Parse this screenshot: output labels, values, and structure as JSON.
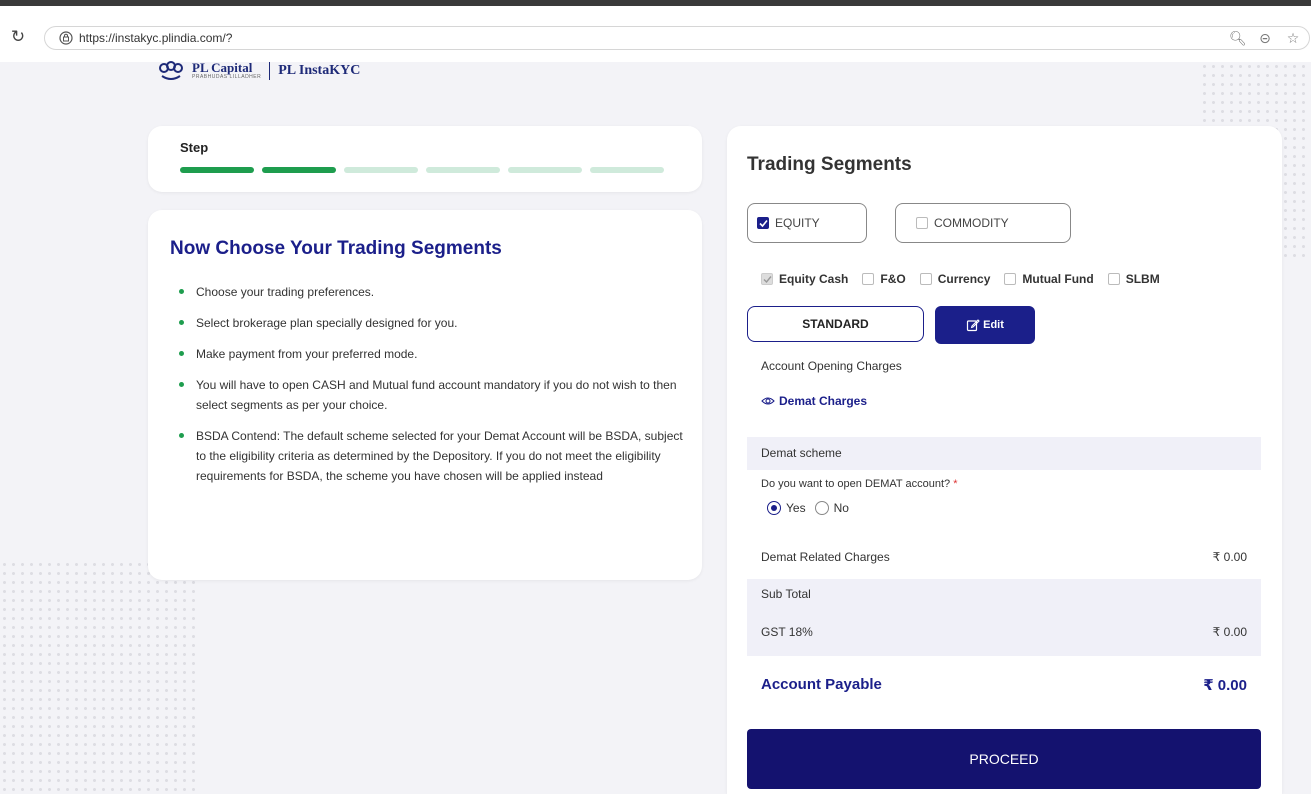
{
  "browser": {
    "url": "https://instakyc.plindia.com/?",
    "reload_icon": "reload-icon",
    "zoom_icon": "zoom-icon",
    "minus_icon": "zoom-out-icon",
    "star_icon": "bookmark-star-icon"
  },
  "logo": {
    "brand": "PL Capital",
    "tagline": "PRABHUDAS LILLADHER",
    "product": "PL InstaKYC"
  },
  "steps": {
    "label": "Step",
    "total": 6,
    "completed": 2
  },
  "info": {
    "title": "Now Choose Your Trading Segments",
    "bullets": [
      "Choose your trading preferences.",
      "Select brokerage plan specially designed for you.",
      "Make payment from your preferred mode.",
      "You will have to open CASH and Mutual fund account mandatory if you do not wish to then select segments as per your choice.",
      "BSDA Contend: The default scheme selected for your Demat Account will be BSDA, subject to the eligibility criteria as determined by the Depository. If you do not meet the eligibility requirements for BSDA, the scheme you have chosen will be applied instead"
    ]
  },
  "segments": {
    "title": "Trading Segments",
    "equity_label": "EQUITY",
    "equity_checked": true,
    "commodity_label": "COMMODITY",
    "commodity_checked": false,
    "sub_options": [
      {
        "label": "Equity Cash",
        "state": "checked-disabled"
      },
      {
        "label": "F&O",
        "state": "unchecked"
      },
      {
        "label": "Currency",
        "state": "unchecked"
      },
      {
        "label": "Mutual Fund",
        "state": "unchecked"
      },
      {
        "label": "SLBM",
        "state": "unchecked"
      }
    ],
    "plan_label": "STANDARD",
    "edit_label": "Edit",
    "account_opening_label": "Account Opening Charges",
    "demat_charges_link": "Demat Charges",
    "demat_scheme_label": "Demat scheme",
    "demat_question": "Do you want to open DEMAT account?",
    "required_marker": "*",
    "yes_label": "Yes",
    "no_label": "No",
    "selected_option": "Yes",
    "demat_related_label": "Demat Related Charges",
    "demat_related_value": "₹ 0.00",
    "sub_total_label": "Sub Total",
    "gst_label": "GST 18%",
    "gst_value": "₹ 0.00",
    "payable_label": "Account Payable",
    "payable_value": "₹ 0.00",
    "proceed_label": "PROCEED"
  },
  "colors": {
    "primary": "#1b1f8a",
    "proceed": "#14126f",
    "step_done": "#1e9d4e",
    "step_pending": "#cfeadb",
    "bullet": "#1e9d4e"
  }
}
